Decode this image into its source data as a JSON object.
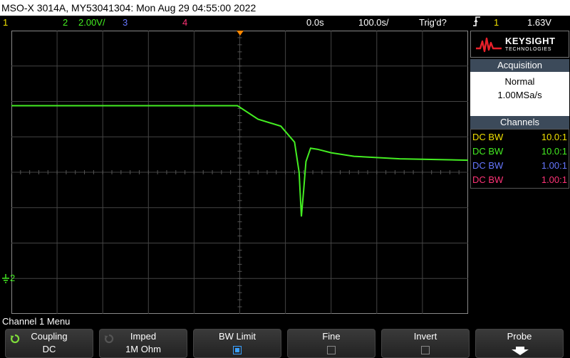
{
  "header": {
    "title": "MSO-X 3014A, MY53041304: Mon Aug 29 04:55:00 2022"
  },
  "status": {
    "ch1": "1",
    "ch2": "2",
    "ch2_scale": "2.00V/",
    "ch3": "3",
    "ch4": "4",
    "time_offset": "0.0s",
    "timebase": "100.0s/",
    "trigger_state": "Trig'd?",
    "trigger_edge_icon": "rising-edge-icon",
    "trigger_source": "1",
    "trigger_level": "1.63V"
  },
  "colors": {
    "ch1": "#f0e000",
    "ch2": "#44ee22",
    "ch3": "#6677ff",
    "ch4": "#ff3377",
    "trigger_marker": "#ff8800"
  },
  "brand": {
    "name": "KEYSIGHT",
    "sub": "TECHNOLOGIES"
  },
  "acquisition": {
    "heading": "Acquisition",
    "mode": "Normal",
    "rate": "1.00MSa/s"
  },
  "channels": {
    "heading": "Channels",
    "rows": [
      {
        "label": "DC BW",
        "value": "10.0:1"
      },
      {
        "label": "DC BW",
        "value": "10.0:1"
      },
      {
        "label": "DC BW",
        "value": "1.00:1"
      },
      {
        "label": "DC BW",
        "value": "1.00:1"
      }
    ]
  },
  "ground_marker": "2",
  "menu": {
    "title": "Channel 1 Menu",
    "softkeys": [
      {
        "label": "Coupling",
        "value": "DC"
      },
      {
        "label": "Imped",
        "value": "1M Ohm"
      },
      {
        "label": "BW Limit",
        "checked": true
      },
      {
        "label": "Fine",
        "checked": false
      },
      {
        "label": "Invert",
        "checked": false
      },
      {
        "label": "Probe"
      }
    ]
  },
  "chart_data": {
    "type": "line",
    "xlabel": "",
    "ylabel": "",
    "x_divisions": 10,
    "y_divisions": 8,
    "grid": true,
    "series": [
      {
        "x": [
          -5.0,
          -0.05,
          0.4,
          0.9,
          1.2,
          1.3,
          1.35,
          1.4,
          1.45,
          1.55,
          1.7,
          2.0,
          2.5,
          3.5,
          5.0
        ],
        "y": [
          1.88,
          1.88,
          1.5,
          1.3,
          0.85,
          0.0,
          -1.25,
          -0.5,
          0.3,
          0.68,
          0.65,
          0.55,
          0.45,
          0.38,
          0.34
        ]
      }
    ]
  }
}
